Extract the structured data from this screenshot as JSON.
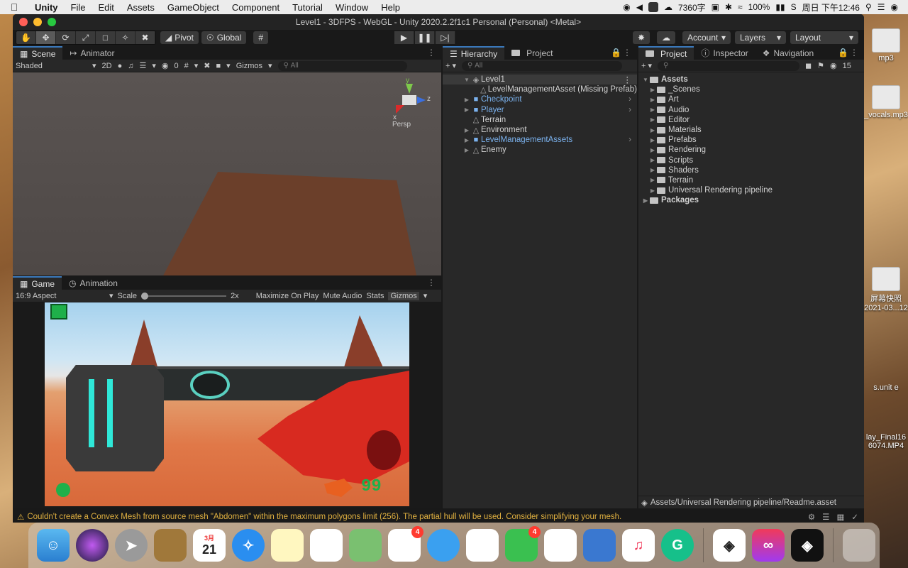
{
  "menubar": {
    "app_name": "Unity",
    "menus": [
      "File",
      "Edit",
      "Assets",
      "GameObject",
      "Component",
      "Tutorial",
      "Window",
      "Help"
    ],
    "word_count": "7360字",
    "battery": "100%",
    "clock": "周日 下午12:46"
  },
  "window": {
    "title": "Level1 - 3DFPS - WebGL - Unity 2020.2.2f1c1 Personal (Personal) <Metal>"
  },
  "toolbar": {
    "pivot": "Pivot",
    "global": "Global",
    "account": "Account",
    "layers": "Layers",
    "layout": "Layout"
  },
  "scene": {
    "tab_scene": "Scene",
    "tab_animator": "Animator",
    "shading_mode": "Shaded",
    "mode_2d": "2D",
    "hidden_count": "0",
    "gizmos": "Gizmos",
    "search_placeholder": "All",
    "persp_label": "Persp",
    "axis_y": "y",
    "axis_z": "z",
    "axis_x": "x"
  },
  "game": {
    "tab_game": "Game",
    "tab_animation": "Animation",
    "aspect": "16:9 Aspect",
    "scale_label": "Scale",
    "scale_value": "2x",
    "maximize": "Maximize On Play",
    "mute": "Mute Audio",
    "stats": "Stats",
    "gizmos": "Gizmos",
    "ammo": "99"
  },
  "hierarchy": {
    "tab_hierarchy": "Hierarchy",
    "tab_project": "Project",
    "search_placeholder": "All",
    "scene_name": "Level1",
    "items": [
      {
        "label": "LevelManagementAsset (Missing Prefab)",
        "color": "#d2d2d2"
      },
      {
        "label": "Checkpoint",
        "color": "#7bb2ee"
      },
      {
        "label": "Player",
        "color": "#7bb2ee"
      },
      {
        "label": "Terrain",
        "color": "#d2d2d2"
      },
      {
        "label": "Environment",
        "color": "#d2d2d2"
      },
      {
        "label": "LevelManagementAssets",
        "color": "#7bb2ee"
      },
      {
        "label": "Enemy",
        "color": "#d2d2d2"
      }
    ]
  },
  "project": {
    "tab_project": "Project",
    "tab_inspector": "Inspector",
    "tab_navigation": "Navigation",
    "hidden_count": "15",
    "root_assets": "Assets",
    "folders": [
      "_Scenes",
      "Art",
      "Audio",
      "Editor",
      "Materials",
      "Prefabs",
      "Rendering",
      "Scripts",
      "Shaders",
      "Terrain",
      "Universal Rendering pipeline"
    ],
    "root_packages": "Packages",
    "selected_path": "Assets/Universal Rendering pipeline/Readme.asset"
  },
  "status": {
    "message": "Couldn't create a Convex Mesh from source mesh \"Abdomen\" within the maximum polygons limit (256). The partial hull will be used. Consider simplifying your mesh."
  },
  "desktop_files": [
    {
      "label": "mp3"
    },
    {
      "label": "_vocals.mp3"
    },
    {
      "label": "屏幕快照 2021-03...12"
    },
    {
      "label": "s.unit e"
    },
    {
      "label": "lay_Final16 6074.MP4"
    }
  ],
  "dock": {
    "calendar_month": "3月",
    "calendar_day": "21",
    "photos_badge": "4",
    "facetime_badge": "4"
  }
}
